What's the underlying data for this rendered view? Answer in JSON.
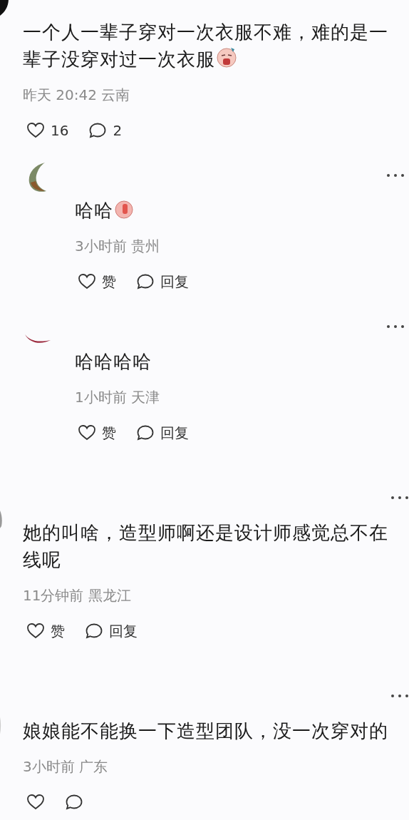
{
  "comments": [
    {
      "kind": "comment",
      "avatar": {
        "kind": "dark"
      },
      "text": "一个人一辈子穿对一次衣服不难，难的是一辈子没穿对过一次衣服",
      "emoji": {
        "kind": "crying"
      },
      "meta": "昨天 20:42 云南",
      "actions": {
        "like": "16",
        "reply": "2"
      },
      "more": false
    },
    {
      "kind": "reply",
      "avatar": {
        "kind": "crescent"
      },
      "text": "哈哈",
      "emoji": {
        "kind": "thumbs"
      },
      "meta": "3小时前 贵州",
      "actions": {
        "like": "赞",
        "reply": "回复"
      },
      "more": true
    },
    {
      "kind": "reply",
      "avatar": {
        "kind": "sliver"
      },
      "text": "哈哈哈哈",
      "meta": "1小时前 天津",
      "actions": {
        "like": "赞",
        "reply": "回复"
      },
      "more": true
    },
    {
      "kind": "comment",
      "avatar": {
        "kind": "grey"
      },
      "text": "她的叫啥，造型师啊还是设计师感觉总不在线呢",
      "meta": "11分钟前 黑龙江",
      "actions": {
        "like": "赞",
        "reply": "回复"
      },
      "more": true
    },
    {
      "kind": "comment",
      "avatar": {
        "kind": "faint"
      },
      "text": "娘娘能不能换一下造型团队，没一次穿对的",
      "meta": "3小时前 广东",
      "more": true
    }
  ]
}
